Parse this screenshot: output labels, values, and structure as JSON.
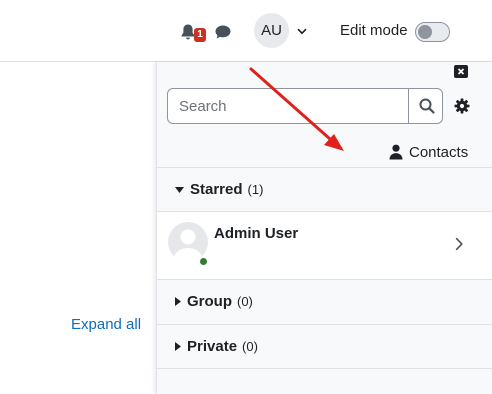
{
  "navbar": {
    "notification_count": "1",
    "user_initials": "AU",
    "edit_mode_label": "Edit mode",
    "edit_mode_on": false
  },
  "page": {
    "expand_all": "Expand all"
  },
  "drawer": {
    "search": {
      "placeholder": "Search",
      "value": ""
    },
    "contacts_label": "Contacts",
    "sections": {
      "starred": {
        "title": "Starred",
        "count": "(1)",
        "expanded": true
      },
      "group": {
        "title": "Group",
        "count": "(0)",
        "expanded": false
      },
      "private": {
        "title": "Private",
        "count": "(0)",
        "expanded": false
      }
    },
    "starred_contacts": [
      {
        "name": "Admin User",
        "status": "online"
      }
    ]
  },
  "icons": {
    "notifications": "bell-icon",
    "messages": "chat-icon",
    "user_menu": "chevron-down-icon",
    "close_drawer": "close-icon",
    "search": "search-icon",
    "settings": "gear-icon",
    "contacts": "user-icon",
    "section_expanded": "caret-down-icon",
    "section_collapsed": "caret-right-icon",
    "open_conversation": "chevron-right-icon"
  },
  "colors": {
    "accent_link": "#0f6cbf",
    "badge": "#ca3120",
    "online": "#357a32",
    "annotation_arrow": "#e0201b"
  }
}
